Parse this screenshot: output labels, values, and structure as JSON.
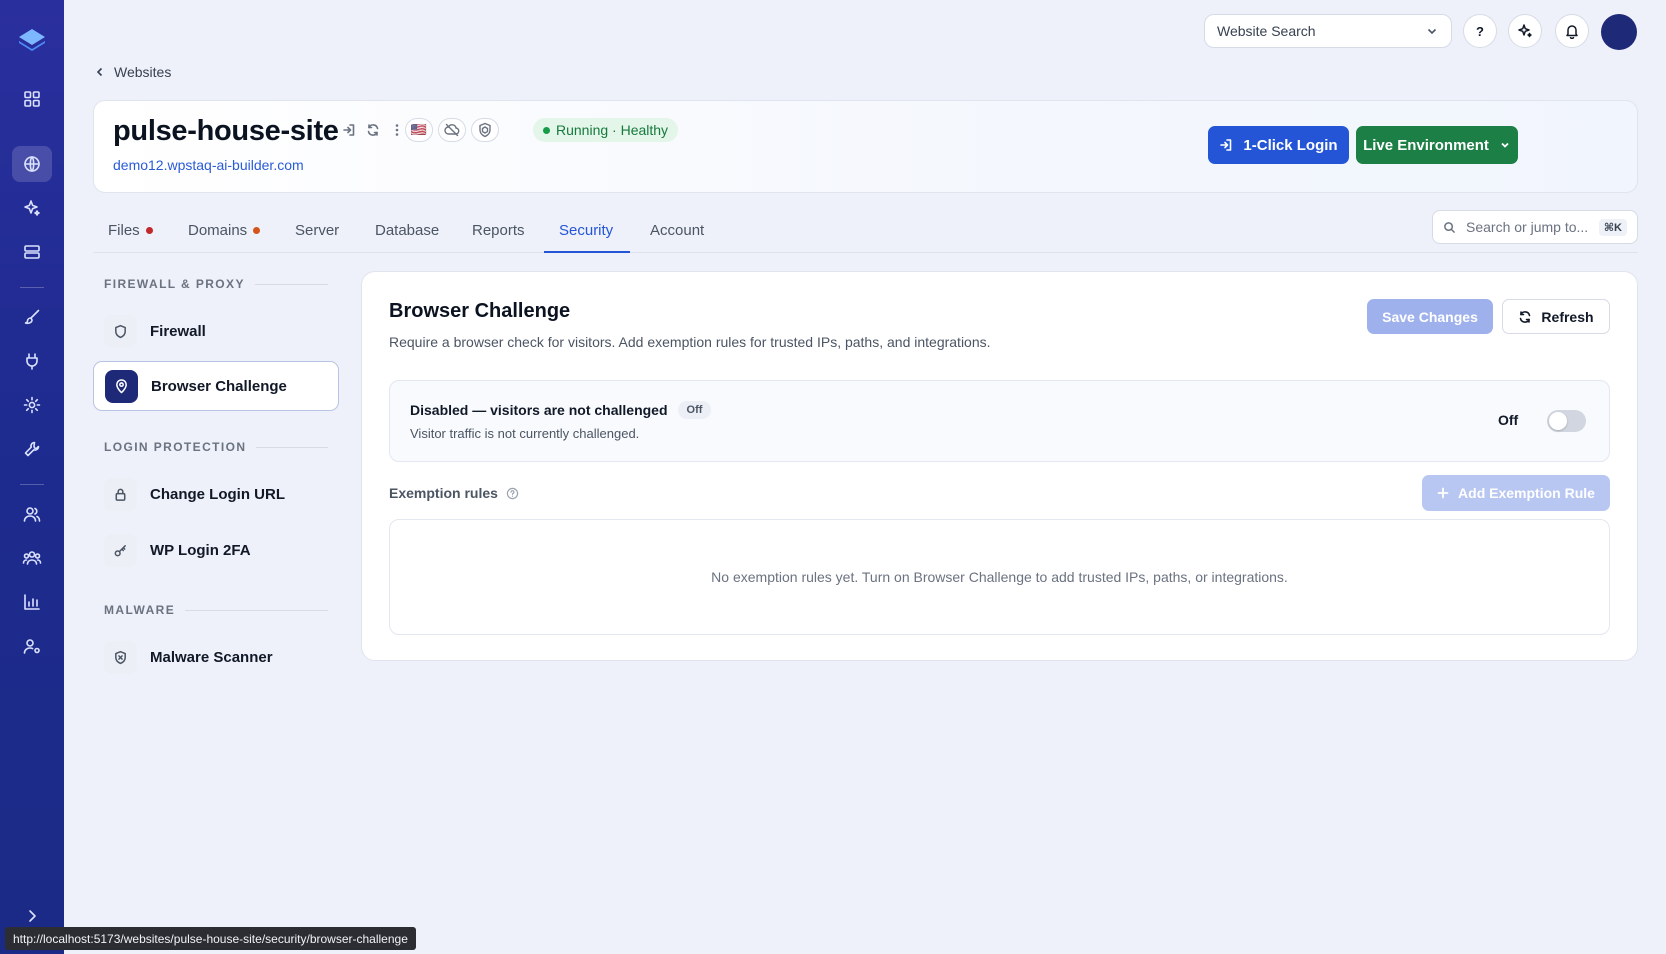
{
  "topbar": {
    "search_label": "Website Search",
    "help_label": "?"
  },
  "breadcrumb": {
    "back_label": "Websites"
  },
  "site": {
    "title": "pulse-house-site",
    "url": "demo12.wpstaq-ai-builder.com",
    "flag": "🇺🇸",
    "status": "Running · Healthy",
    "login_button": "1-Click Login",
    "env_button": "Live Environment"
  },
  "tabs": [
    {
      "label": "Files",
      "dot": "#c0282a"
    },
    {
      "label": "Domains",
      "dot": "#d4541b"
    },
    {
      "label": "Server"
    },
    {
      "label": "Database"
    },
    {
      "label": "Reports"
    },
    {
      "label": "Security",
      "active": true
    },
    {
      "label": "Account"
    }
  ],
  "jump": {
    "placeholder": "Search or jump to...",
    "shortcut": "⌘K"
  },
  "subnav": {
    "sections": [
      {
        "title": "FIREWALL & PROXY"
      },
      {
        "title": "LOGIN PROTECTION"
      },
      {
        "title": "MALWARE"
      }
    ],
    "items": [
      {
        "label": "Firewall"
      },
      {
        "label": "Browser Challenge",
        "active": true
      },
      {
        "label": "Change Login URL"
      },
      {
        "label": "WP Login 2FA"
      },
      {
        "label": "Malware Scanner"
      }
    ]
  },
  "panel": {
    "title": "Browser Challenge",
    "description": "Require a browser check for visitors. Add exemption rules for trusted IPs, paths, and integrations.",
    "save_label": "Save Changes",
    "refresh_label": "Refresh",
    "state_title": "Disabled — visitors are not challenged",
    "state_badge": "Off",
    "state_sub": "Visitor traffic is not currently challenged.",
    "toggle_label": "Off",
    "toggle_on": false,
    "exemption_label": "Exemption rules",
    "add_rule_label": "Add Exemption Rule",
    "empty_text": "No exemption rules yet. Turn on Browser Challenge to add trusted IPs, paths, or integrations."
  },
  "statusbar": {
    "url": "http://localhost:5173/websites/pulse-house-site/security/browser-challenge"
  },
  "colors": {
    "accent": "#2355d6",
    "env_green": "#1b7f46",
    "rail": "#1e2b8f"
  }
}
